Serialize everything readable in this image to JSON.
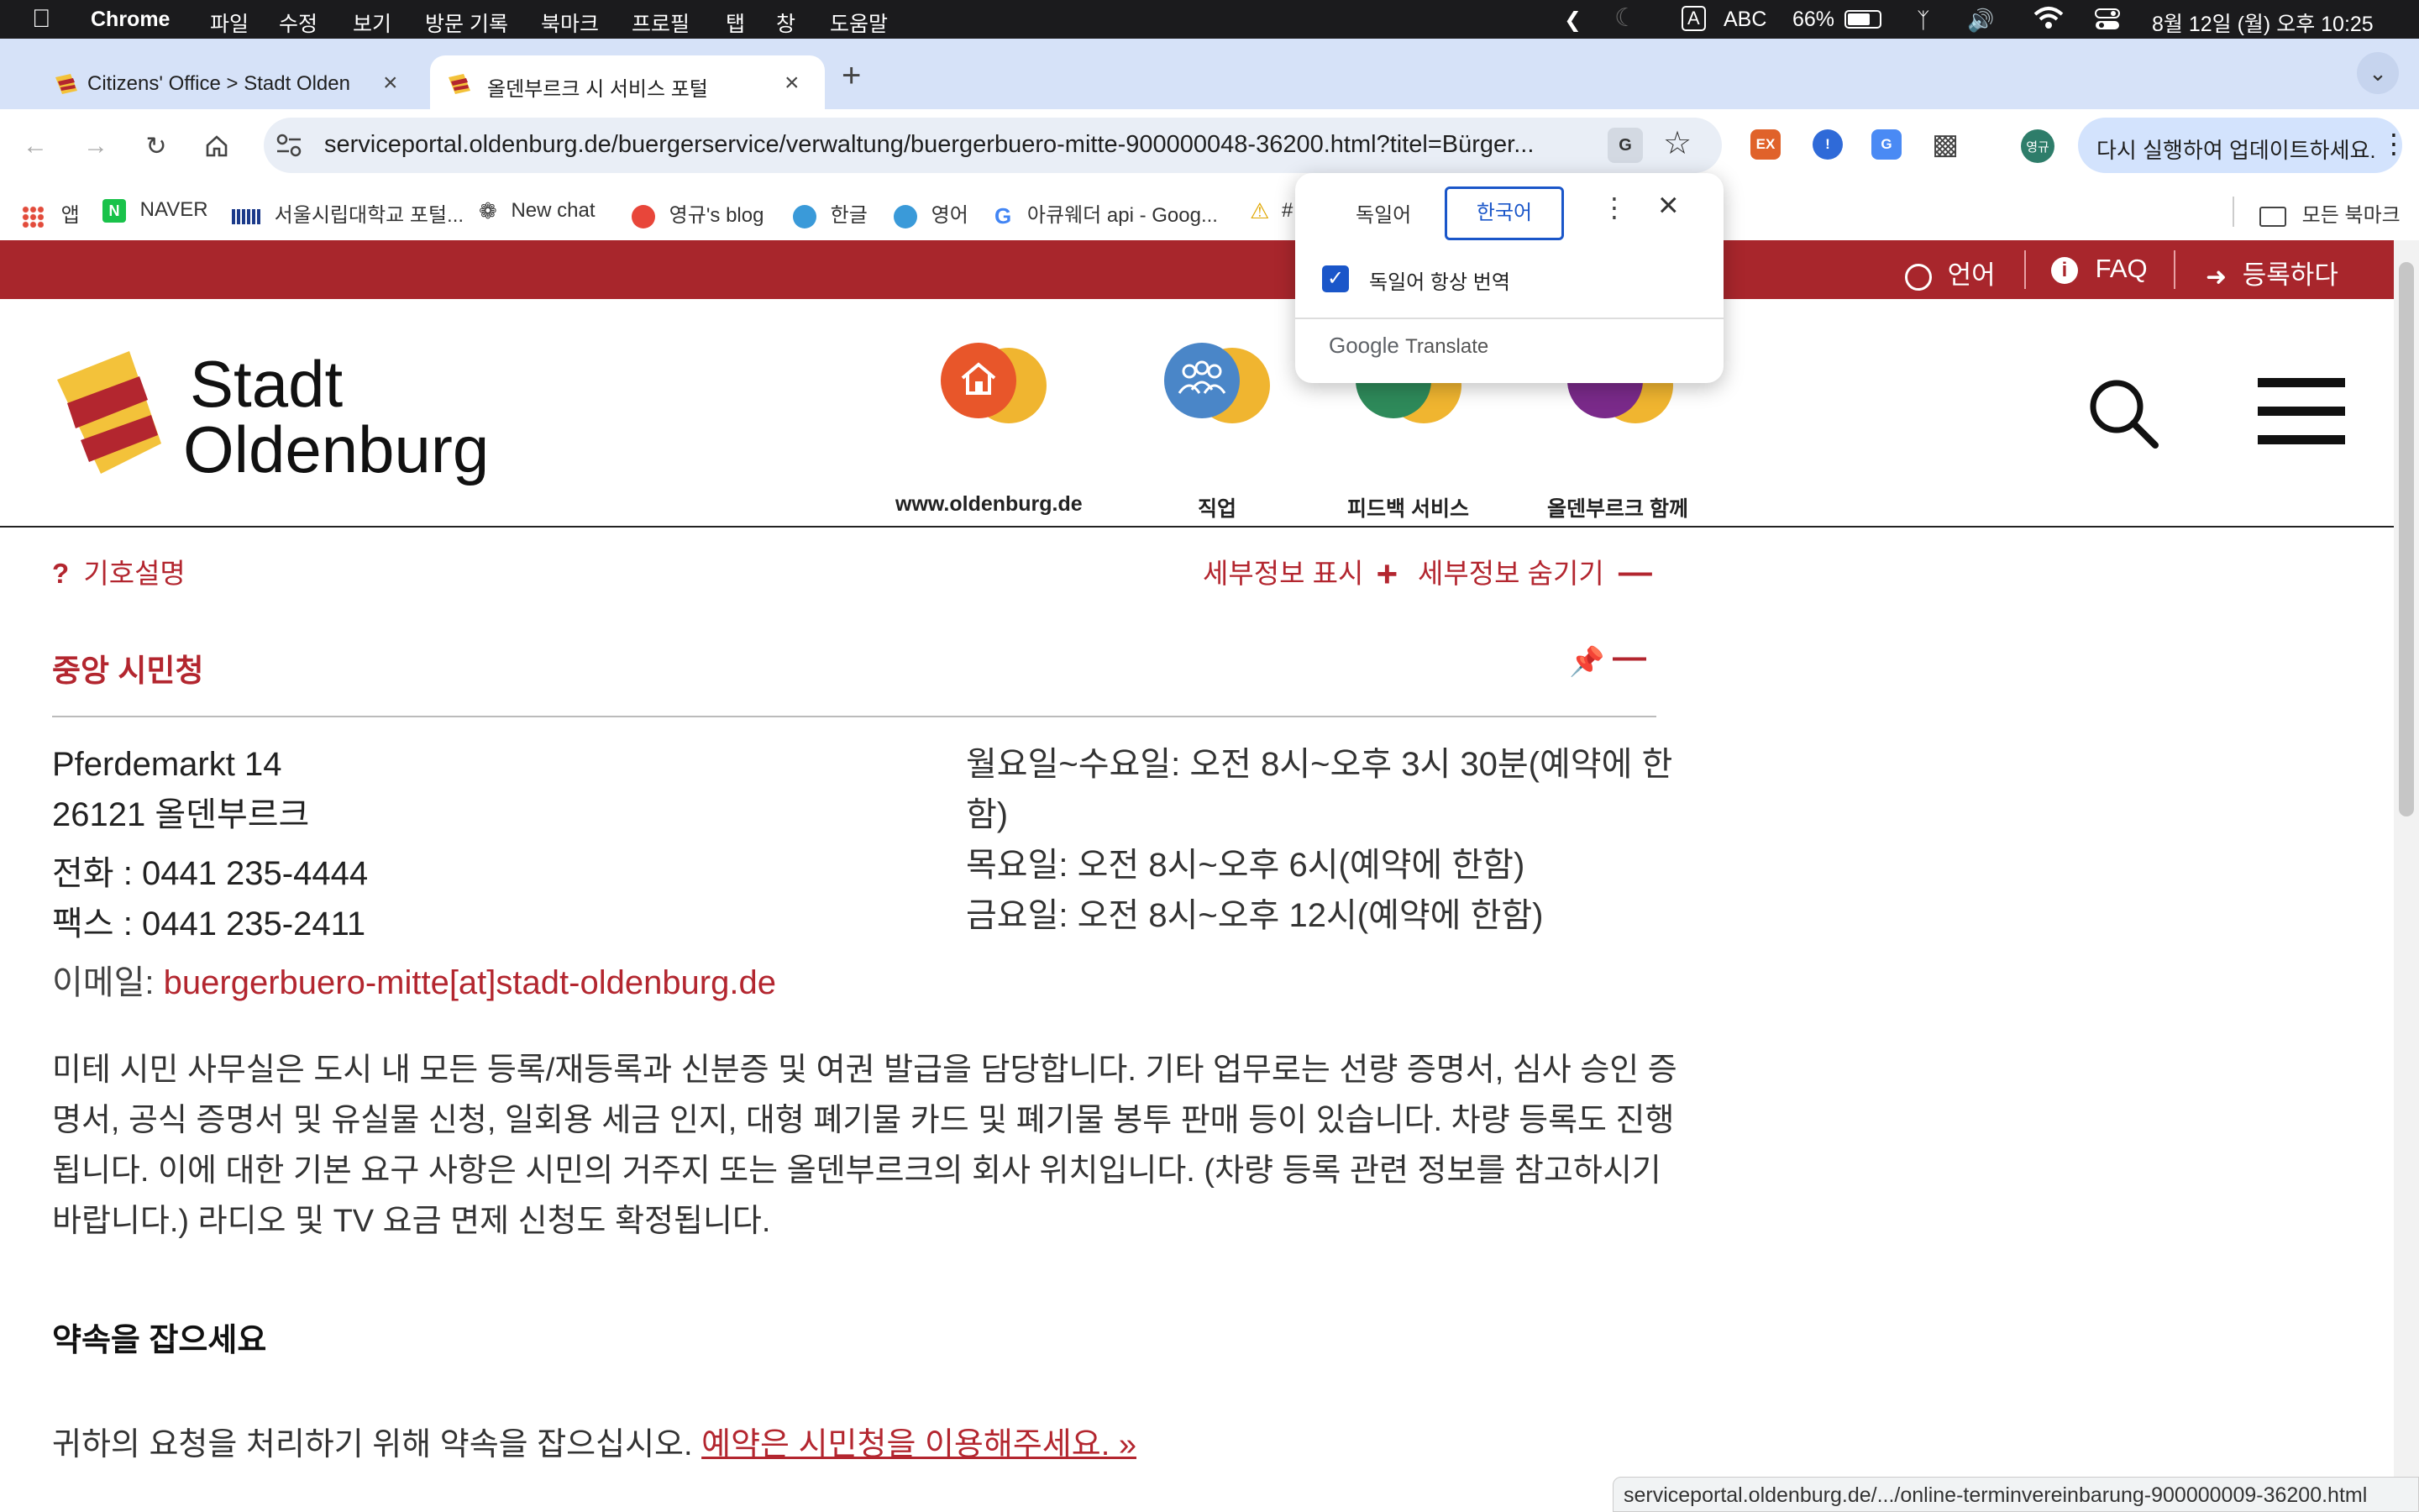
{
  "macos_menu": {
    "app": "Chrome",
    "items": [
      "파일",
      "수정",
      "보기",
      "방문 기록",
      "북마크",
      "프로필",
      "탭",
      "창",
      "도움말"
    ],
    "input_badge": "A",
    "input_source": "ABC",
    "battery": "66%",
    "datetime": "8월 12일 (월) 오후 10:25"
  },
  "tabs": [
    {
      "title": "Citizens' Office > Stadt Olden",
      "active": false
    },
    {
      "title": "올덴부르크 시 서비스 포털",
      "active": true
    }
  ],
  "address_bar": {
    "url": "serviceportal.oldenburg.de/buergerservice/verwaltung/buergerbuero-mitte-900000048-36200.html?titel=Bürger..."
  },
  "update_button": "다시 실행하여 업데이트하세요.",
  "profile_initial": "영규",
  "bookmarks": [
    "앱",
    "NAVER",
    "서울시립대학교 포털...",
    "New chat",
    "영규's blog",
    "한글",
    "영어",
    "아큐웨더 api - Goog...",
    "#"
  ],
  "all_bookmarks": "모든 북마크",
  "translate_popup": {
    "tab_source": "독일어",
    "tab_target": "한국어",
    "always_translate": "독일어 항상 번역",
    "brand_google": "Google",
    "brand_translate": "Translate"
  },
  "topbar_links": {
    "language": "언어",
    "faq": "FAQ",
    "register": "등록하다"
  },
  "logo": {
    "line1": "Stadt",
    "line2": "Oldenburg"
  },
  "nav_icons": [
    {
      "label": "www.oldenburg.de",
      "color": "#e8562a"
    },
    {
      "label": "직업",
      "color": "#4a86c8"
    },
    {
      "label": "피드백 서비스",
      "color": "#2e8a5a"
    },
    {
      "label": "올덴부르크 함께",
      "color": "#7a2a8a"
    }
  ],
  "legend_link": "기호설명",
  "show_details": "세부정보 표시",
  "hide_details": "세부정보 숨기기",
  "office": {
    "title": "중앙 시민청",
    "street": "Pferdemarkt 14",
    "city": "26121 올덴부르크",
    "phone_label": "전화 :",
    "phone": "0441 235-4444",
    "fax_label": "팩스 :",
    "fax": "0441 235-2411",
    "email_label": "이메일:",
    "email": "buergerbuero-mitte[at]stadt-oldenburg.de",
    "hours": [
      "월요일~수요일: 오전 8시~오후 3시 30분(예약에 한",
      "함)",
      "목요일: 오전 8시~오후 6시(예약에 한함)",
      "금요일: 오전 8시~오후 12시(예약에 한함)"
    ],
    "description": [
      "미테 시민 사무실은 도시 내 모든 등록/재등록과 신분증 및 여권 발급을 담당합니다. 기타 업무로는 선량 증명서, 심사 승인 증",
      "명서, 공식 증명서 및 유실물 신청, 일회용 세금 인지, 대형 폐기물 카드 및 폐기물 봉투 판매 등이 있습니다. 차량 등록도 진행",
      "됩니다. 이에 대한 기본 요구 사항은 시민의 거주지 또는 올덴부르크의 회사 위치입니다. (차량 등록 관련 정보를 참고하시기",
      "바랍니다.) 라디오 및 TV 요금 면제 신청도 확정됩니다."
    ],
    "appointment_heading": "약속을 잡으세요",
    "appointment_text": "귀하의 요청을 처리하기 위해 약속을 잡으십시오.",
    "appointment_link": "예약은 시민청을 이용해주세요. »"
  },
  "status_url": "serviceportal.oldenburg.de/.../online-terminvereinbarung-900000009-36200.html",
  "colors": {
    "brand_red": "#a8262c",
    "link_red": "#b3262f",
    "chrome_blue": "#d6e2f8"
  }
}
